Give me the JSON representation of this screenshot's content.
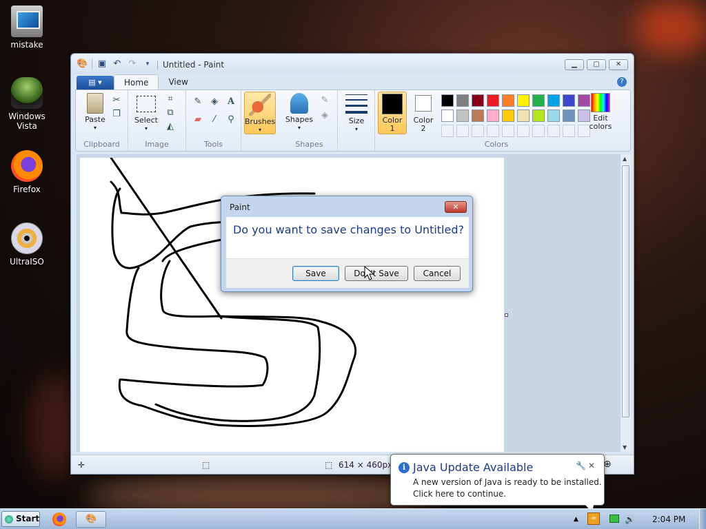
{
  "desktop": {
    "icons": [
      {
        "label": "mistake"
      },
      {
        "label": "Windows Vista"
      },
      {
        "label": "Firefox"
      },
      {
        "label": "UltraISO"
      }
    ]
  },
  "paint": {
    "title": "Untitled - Paint",
    "tabs": [
      "Home",
      "View"
    ],
    "groups": {
      "clipboard": {
        "label": "Clipboard",
        "paste": "Paste"
      },
      "image": {
        "label": "Image",
        "select": "Select"
      },
      "tools": {
        "label": "Tools"
      },
      "brushes": {
        "label": "Brushes"
      },
      "shapes": {
        "label": "Shapes",
        "shapes_btn": "Shapes"
      },
      "size": {
        "label": "Size"
      },
      "colors": {
        "label": "Colors",
        "color1": "Color 1",
        "color2": "Color 2",
        "edit": "Edit colors"
      }
    },
    "palette": {
      "row1": [
        "#000000",
        "#7f7f7f",
        "#880015",
        "#ed1c24",
        "#ff7f27",
        "#fff200",
        "#22b14c",
        "#00a2e8",
        "#3f48cc",
        "#a349a4"
      ],
      "row2": [
        "#ffffff",
        "#c3c3c3",
        "#b97a57",
        "#ffaec9",
        "#ffc90e",
        "#efe4b0",
        "#b5e61d",
        "#99d9ea",
        "#7092be",
        "#c8bfe7"
      ]
    },
    "color1": "#000000",
    "color2": "#ffffff",
    "status": {
      "dimensions": "614 × 460px"
    }
  },
  "dialog": {
    "title": "Paint",
    "message": "Do you want to save changes to Untitled?",
    "buttons": {
      "save": "Save",
      "dont_save": "Don't Save",
      "cancel": "Cancel"
    }
  },
  "notification": {
    "title": "Java Update Available",
    "line1": "A new version of Java is ready to be installed.",
    "line2": "Click here to continue."
  },
  "taskbar": {
    "start": "Start",
    "clock": "2:04 PM"
  }
}
